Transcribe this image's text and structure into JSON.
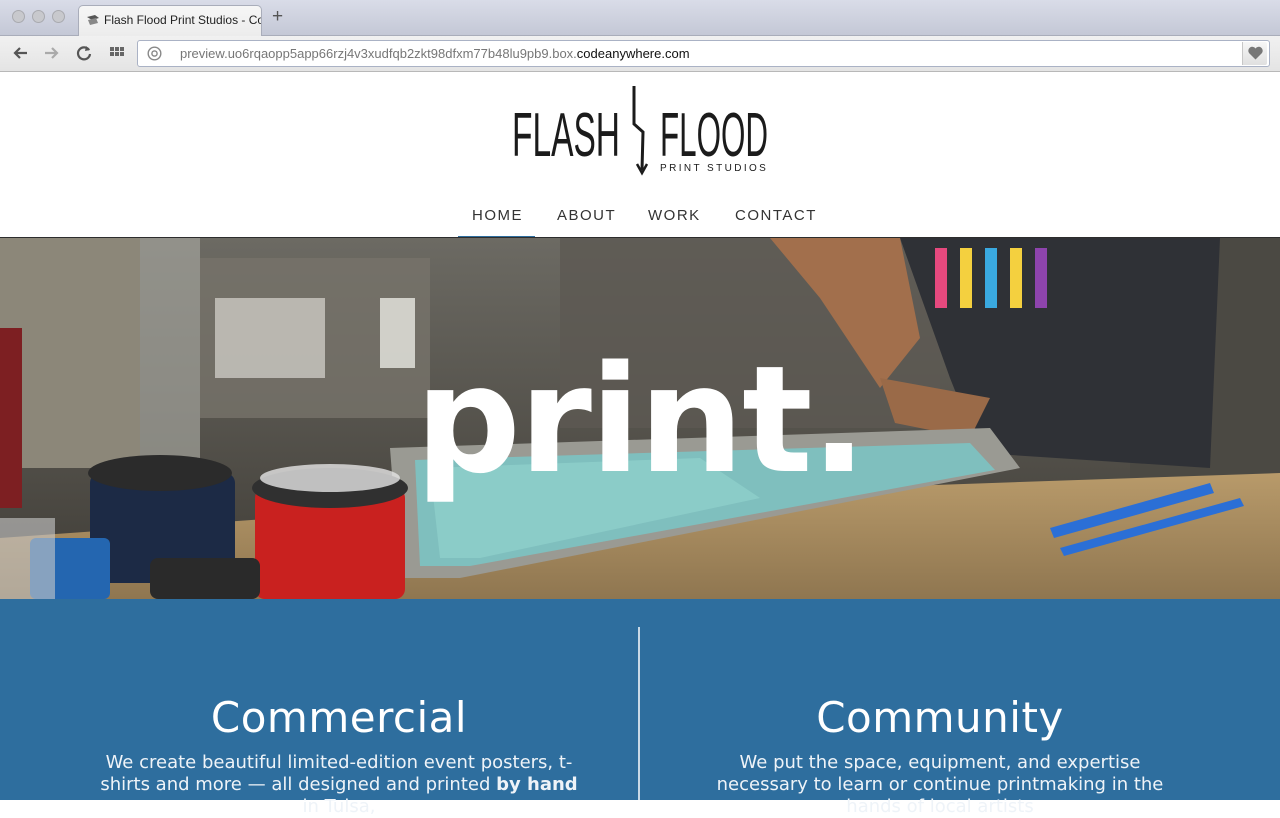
{
  "browser": {
    "tab_title": "Flash Flood Print Studios - Codeanywhere",
    "new_tab_label": "+",
    "url_prefix": "preview.uo6rqaopp5app66rzj4v3xudfqb2zkt98dfxm77b48lu9pb9.box.",
    "url_domain": "codeanywhere.com"
  },
  "site": {
    "logo": {
      "left_word": "FLASH",
      "right_word": "FLOOD",
      "tagline": "PRINT STUDIOS"
    },
    "nav": [
      {
        "label": "HOME",
        "active": true
      },
      {
        "label": "ABOUT",
        "active": false
      },
      {
        "label": "WORK",
        "active": false
      },
      {
        "label": "CONTACT",
        "active": false
      }
    ],
    "hero": {
      "headline": "print."
    },
    "features": {
      "commercial": {
        "title": "Commercial",
        "text_before": "We create beautiful limited-edition event posters, t-shirts and more — all designed and printed ",
        "emphasis": "by hand",
        "text_after": " in Tulsa,"
      },
      "community": {
        "title": "Community",
        "text": "We put the space, equipment, and expertise necessary to learn or continue printmaking in the hands of local artists"
      }
    }
  },
  "colors": {
    "brand_blue": "#2e6e9e",
    "nav_text": "#333333",
    "hero_text": "#ffffff"
  },
  "icons": [
    "back-arrow-icon",
    "forward-arrow-icon",
    "reload-icon",
    "apps-grid-icon",
    "globe-icon",
    "heart-icon",
    "lightning-bolt-icon"
  ]
}
